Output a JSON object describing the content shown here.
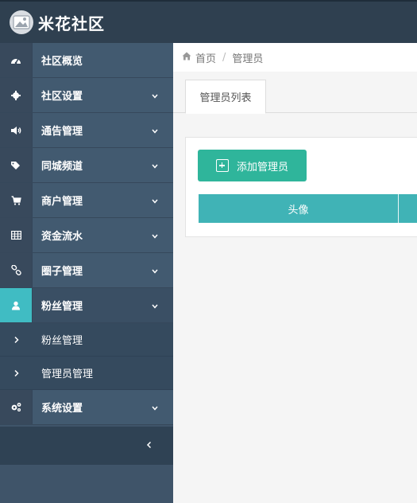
{
  "app": {
    "title": "米花社区"
  },
  "sidebar": {
    "items": [
      {
        "label": "社区概览",
        "icon": "dashboard-icon",
        "chevron": false
      },
      {
        "label": "社区设置",
        "icon": "gear-icon",
        "chevron": true
      },
      {
        "label": "通告管理",
        "icon": "volume-icon",
        "chevron": true
      },
      {
        "label": "同城频道",
        "icon": "tags-icon",
        "chevron": true
      },
      {
        "label": "商户管理",
        "icon": "cart-icon",
        "chevron": true
      },
      {
        "label": "资金流水",
        "icon": "table-icon",
        "chevron": true
      },
      {
        "label": "圈子管理",
        "icon": "link-icon",
        "chevron": true
      },
      {
        "label": "粉丝管理",
        "icon": "user-icon",
        "chevron": true,
        "active": true
      }
    ],
    "sub_items": [
      {
        "label": "粉丝管理",
        "icon": "chevron-right-icon"
      },
      {
        "label": "管理员管理",
        "icon": "chevron-right-icon"
      }
    ],
    "bottom_item": {
      "label": "系统设置",
      "icon": "gears-icon",
      "chevron": true
    },
    "collapse_icon": "chevron-left-icon"
  },
  "breadcrumb": {
    "home": "首页",
    "separator": "/",
    "current": "管理员"
  },
  "tabs": [
    {
      "label": "管理员列表",
      "active": true
    }
  ],
  "toolbar": {
    "add_label": "添加管理员"
  },
  "table": {
    "columns": [
      "头像"
    ]
  },
  "colors": {
    "topbar": "#2f4050",
    "sidebar": "#425a70",
    "accent": "#40bcc3",
    "button": "#2fb59b",
    "table_header": "#40b3b6"
  }
}
